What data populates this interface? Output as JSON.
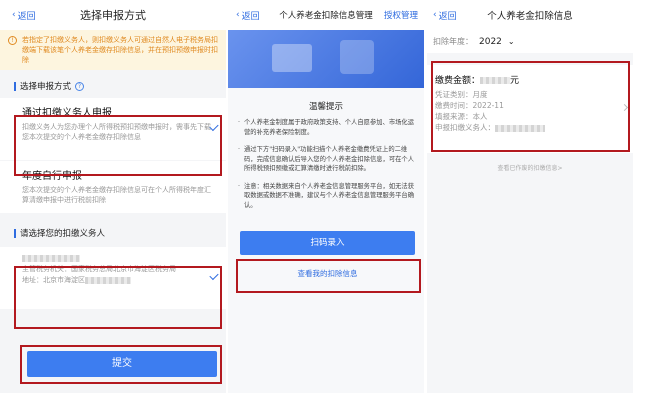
{
  "p1": {
    "back": "返回",
    "title": "选择申报方式",
    "notice": "若指定了扣缴义务人，则扣缴义务人可通过自然人电子税务局扣缴端下载该笔个人养老金缴存扣除信息，并在预扣预缴申报时扣除",
    "section1": "选择申报方式",
    "opt1_title": "通过扣缴义务人申报",
    "opt1_desc": "扣缴义务人为您办理个人所得税预扣预缴申报时，需事先下载您本次提交的个人养老金缴存扣除信息",
    "opt2_title": "年度自行申报",
    "opt2_desc": "您本次提交的个人养老金缴存扣除信息可在个人所得税年度汇算清缴申报中进行税前扣除",
    "section2": "请选择您的扣缴义务人",
    "agent_authority": "主管税务机关：国家税务总局北京市海淀区税务局",
    "agent_address": "地址：北京市海淀区",
    "submit": "提交"
  },
  "p2": {
    "back": "返回",
    "title": "个人养老金扣除信息管理",
    "right": "授权管理",
    "tip_title": "温馨提示",
    "tips": [
      "个人养老金制度属于政府政策支持、个人自愿参加、市场化运营的补充养老保险制度。",
      "通过下方\"扫码录入\"功能扫描个人养老金缴费凭证上的二维码，完成信息确认后导入您的个人养老金扣除信息，可在个人所得税预扣预缴或汇算清缴时进行税前扣除。",
      "注意：相关数据来自个人养老金信息管理服务平台，如无法获取数据或数据不准确，建议与个人养老金信息管理服务平台确认。"
    ],
    "scan": "扫码录入",
    "view": "查看我的扣除信息"
  },
  "p3": {
    "back": "返回",
    "title": "个人养老金扣除信息",
    "year_label": "扣除年度：",
    "year_value": "2022",
    "amount_label": "缴费金额：",
    "amount_unit": "元",
    "type": "凭证类别：月度",
    "time": "缴费时间：2022-11",
    "source": "填报来源：本人",
    "agent": "申报扣缴义务人：",
    "prev": "查看已作废的扣缴信息>"
  },
  "colors": {
    "accent": "#3d7df0",
    "highlight": "#b3191f",
    "warning": "#e08a21"
  }
}
